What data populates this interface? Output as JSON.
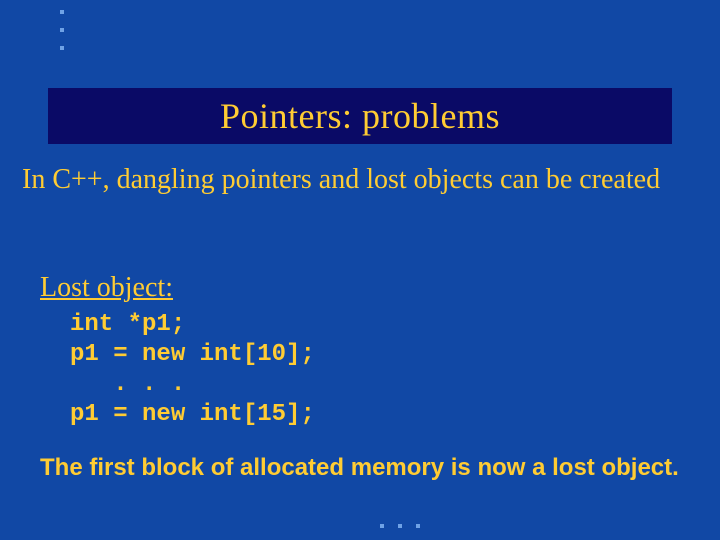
{
  "title": "Pointers:  problems",
  "intro": "In C++, dangling pointers and lost objects can be created",
  "subhead": "Lost object:",
  "code": "int *p1;\np1 = new int[10];\n   . . .\np1 = new int[15];",
  "closing": "The first block of allocated memory is now a lost object."
}
